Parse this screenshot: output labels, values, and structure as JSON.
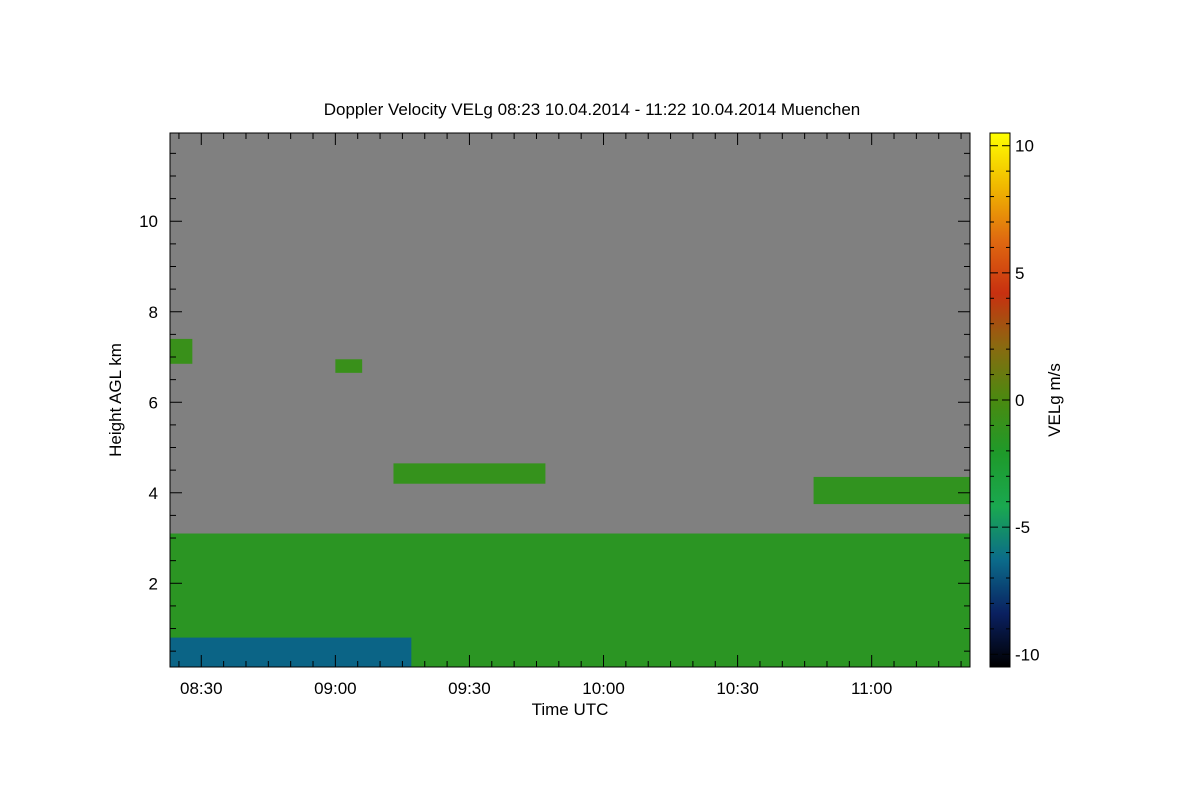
{
  "chart_data": {
    "type": "heatmap",
    "title": "Doppler Velocity VELg   08:23 10.04.2014 - 11:22 10.04.2014 Muenchen",
    "xlabel": "Time UTC",
    "ylabel": "Height AGL km",
    "xlim": [
      "08:23",
      "11:22"
    ],
    "ylim": [
      0.15,
      11.95
    ],
    "x_ticks": [
      "08:30",
      "09:00",
      "09:30",
      "10:00",
      "10:30",
      "11:00"
    ],
    "y_ticks": [
      "2",
      "4",
      "6",
      "8",
      "10"
    ],
    "colorbar": {
      "label": "VELg m/s",
      "range": [
        -10.5,
        10.5
      ],
      "ticks": [
        "10",
        "5",
        "0",
        "-5",
        "-10"
      ],
      "colors": [
        "#000000",
        "#0a2060",
        "#0b6b8a",
        "#1aa850",
        "#1e9a2a",
        "#4a8a10",
        "#8a6a10",
        "#c83010",
        "#e06a10",
        "#f0b800",
        "#ffff00"
      ]
    },
    "background_color": "#808080",
    "regions": [
      {
        "name": "boundary-layer",
        "x0": "08:23",
        "x1": "11:22",
        "y0": 0.15,
        "y1": 3.1,
        "velocity": -1.5
      },
      {
        "name": "near-surface-downdraft",
        "x0": "08:23",
        "x1": "09:17",
        "y0": 0.15,
        "y1": 0.8,
        "velocity": -6.5
      },
      {
        "name": "cloud-layer-4.4km",
        "x0": "09:13",
        "x1": "09:47",
        "y0": 4.2,
        "y1": 4.65,
        "velocity": -1.0
      },
      {
        "name": "cloud-layer-4.1km",
        "x0": "10:47",
        "x1": "11:22",
        "y0": 3.75,
        "y1": 4.35,
        "velocity": -1.2
      },
      {
        "name": "cloud-layer-7km",
        "x0": "08:23",
        "x1": "08:28",
        "y0": 6.85,
        "y1": 7.4,
        "velocity": -0.8
      },
      {
        "name": "cloud-patch-6.8km",
        "x0": "09:00",
        "x1": "09:06",
        "y0": 6.65,
        "y1": 6.95,
        "velocity": -0.8
      }
    ]
  }
}
